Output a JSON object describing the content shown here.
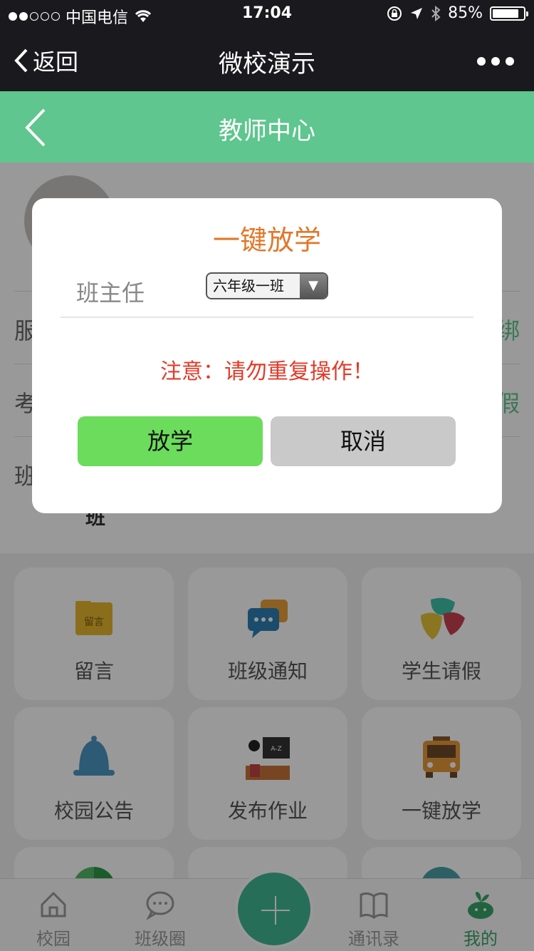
{
  "status_bar": {
    "carrier": "中国电信",
    "time": "17:04",
    "battery": "85%"
  },
  "nav": {
    "back_label": "返回",
    "title": "微校演示"
  },
  "header": {
    "title": "教师中心"
  },
  "profile": {
    "rows": [
      {
        "label": "服",
        "action": "绑"
      },
      {
        "label": "考",
        "action": "假"
      },
      {
        "label": "班",
        "action": ""
      }
    ],
    "class_value": "班"
  },
  "grid": {
    "tiles": [
      {
        "label": "留言",
        "icon": "message-board-icon"
      },
      {
        "label": "班级通知",
        "icon": "class-notice-icon"
      },
      {
        "label": "学生请假",
        "icon": "student-leave-icon"
      },
      {
        "label": "校园公告",
        "icon": "bell-icon"
      },
      {
        "label": "发布作业",
        "icon": "homework-icon"
      },
      {
        "label": "一键放学",
        "icon": "school-bus-icon"
      }
    ]
  },
  "tabbar": {
    "tabs": [
      {
        "label": "校园",
        "icon": "home-icon"
      },
      {
        "label": "班级圈",
        "icon": "chat-bubble-icon"
      },
      {
        "label": "通讯录",
        "icon": "book-icon"
      },
      {
        "label": "我的",
        "icon": "sprout-icon",
        "active": true
      }
    ]
  },
  "dialog": {
    "title": "一键放学",
    "field_label": "班主任",
    "selected_class": "六年级一班",
    "warning": "注意：请勿重复操作！",
    "confirm_label": "放学",
    "cancel_label": "取消"
  },
  "colors": {
    "header_green": "#5ec68e",
    "title_orange": "#e0782b",
    "warning_red": "#e33a28",
    "confirm_green": "#6bdc5b"
  }
}
